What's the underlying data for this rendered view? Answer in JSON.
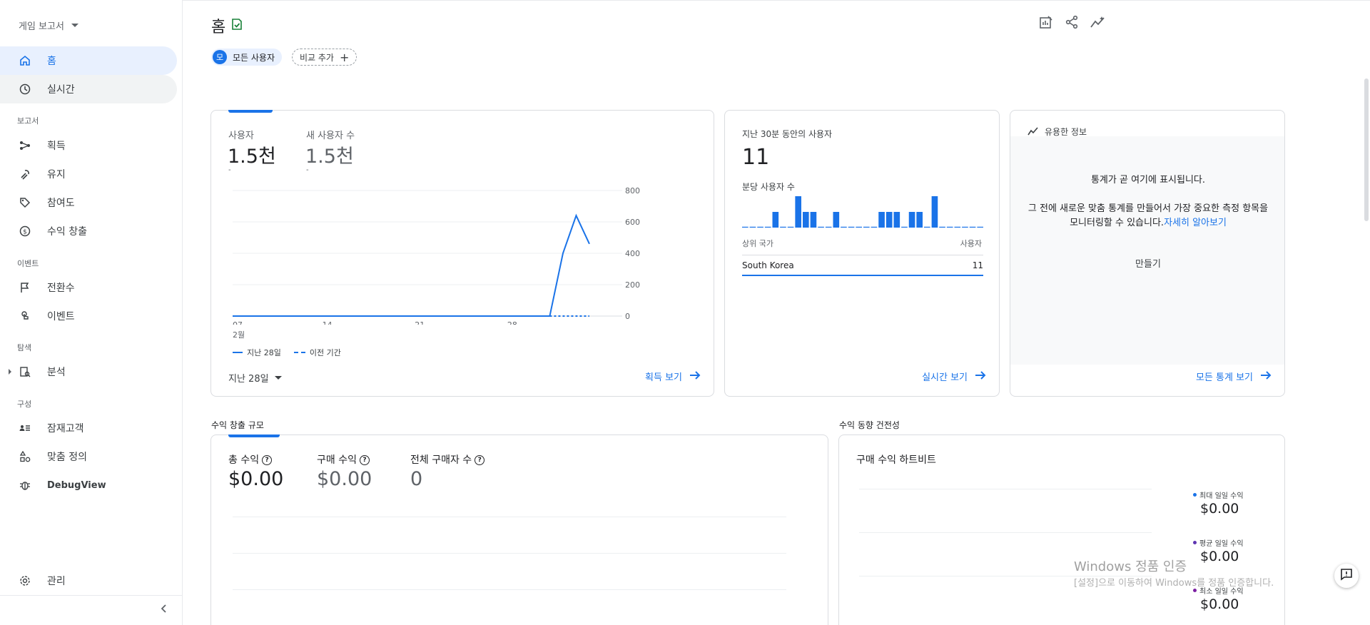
{
  "property": {
    "name": "게임 보고서"
  },
  "nav": {
    "home": "홈",
    "realtime": "실시간",
    "section_reports": "보고서",
    "acquisition": "획득",
    "retention": "유지",
    "engagement": "참여도",
    "monetization": "수익 창출",
    "section_events": "이벤트",
    "conversions": "전환수",
    "events": "이벤트",
    "section_explore": "탐색",
    "analysis": "분석",
    "section_configure": "구성",
    "audiences": "잠재고객",
    "custom_definitions": "맞춤 정의",
    "debugview": "DebugView",
    "admin": "관리"
  },
  "header": {
    "title": "홈",
    "chip_all_avatar": "모",
    "chip_all_label": "모든 사용자",
    "chip_add_label": "비교 추가",
    "chip_add_plus": "+"
  },
  "users_card": {
    "metric1_label": "사용자",
    "metric1_value": "1.5천",
    "metric1_sub": "-",
    "metric2_label": "새 사용자 수",
    "metric2_value": "1.5천",
    "metric2_sub": "-",
    "legend_current": "지난 28일",
    "legend_previous": "이전 기간",
    "date_range": "지난 28일",
    "link": "획득 보기",
    "month_label": "2월"
  },
  "realtime_card": {
    "title": "지난 30분 동안의 사용자",
    "value": "11",
    "per_minute_label": "분당 사용자 수",
    "col_country": "상위 국가",
    "col_users": "사용자",
    "row_country": "South Korea",
    "row_users": "11",
    "link": "실시간 보기"
  },
  "insights_card": {
    "title": "유용한 정보",
    "heading": "통계가 곧 여기에 표시됩니다.",
    "body": "그 전에 새로운 맞춤 통계를 만들어서 가장 중요한 측정 항목을 모니터링할 수 있습니다.",
    "learn_more": "자세히 알아보기",
    "create": "만들기",
    "link": "모든 통계 보기"
  },
  "revenue_section": {
    "title": "수익 창출 규모",
    "metric1_label": "총 수익",
    "metric1_value": "$0.00",
    "metric2_label": "구매 수익",
    "metric2_value": "$0.00",
    "metric3_label": "전체 구매자 수",
    "metric3_value": "0"
  },
  "revenue_trend_section": {
    "title": "수익 동향 건전성",
    "card_title": "구매 수익 하트비트",
    "max_label": "최대 일일 수익",
    "max_value": "$0.00",
    "avg_label": "평균 일일 수익",
    "avg_value": "$0.00",
    "min_label": "최소 일일 수익",
    "min_value": "$0.00"
  },
  "watermark": {
    "line1": "Windows 정품 인증",
    "line2": "[설정]으로 이동하여 Windows를 정품 인증합니다."
  },
  "colors": {
    "accent": "#1a73e8",
    "active_bg": "#e8f0fe",
    "avg_dot": "#5e35b1",
    "min_dot": "#7b1fa2"
  },
  "chart_data": [
    {
      "type": "line",
      "x_tick_labels": [
        "07",
        "14",
        "21",
        "28"
      ],
      "y_tick_labels": [
        "800",
        "600",
        "400",
        "200",
        "0"
      ],
      "ylim": [
        0,
        800
      ],
      "series": [
        {
          "name": "지난 28일",
          "values": [
            0,
            0,
            0,
            0,
            0,
            0,
            0,
            0,
            0,
            0,
            0,
            0,
            0,
            0,
            0,
            0,
            0,
            0,
            0,
            0,
            0,
            0,
            0,
            0,
            0,
            400,
            640,
            460
          ]
        },
        {
          "name": "이전 기간",
          "values": [
            0,
            0,
            0,
            0,
            0,
            0,
            0,
            0,
            0,
            0,
            0,
            0,
            0,
            0,
            0,
            0,
            0,
            0,
            0,
            0,
            0,
            0,
            0,
            0,
            0,
            0,
            0,
            0
          ]
        }
      ]
    },
    {
      "type": "bar",
      "values": [
        0,
        0,
        0,
        0,
        2,
        0,
        0,
        4,
        2,
        2,
        0,
        0,
        2,
        0,
        0,
        0,
        0,
        0,
        2,
        2,
        2,
        0,
        2,
        2,
        0,
        4,
        0,
        0,
        0,
        0,
        0,
        0
      ]
    }
  ]
}
